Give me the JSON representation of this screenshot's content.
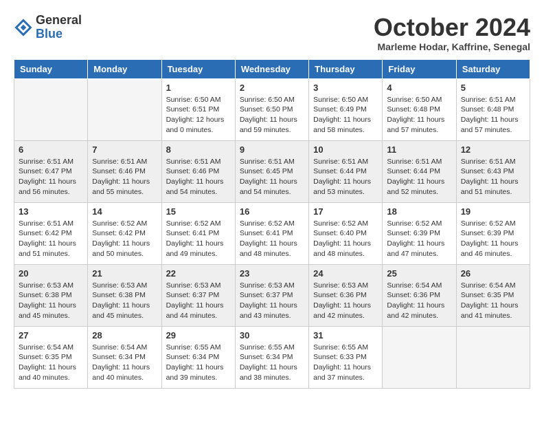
{
  "header": {
    "logo_general": "General",
    "logo_blue": "Blue",
    "month": "October 2024",
    "location": "Marleme Hodar, Kaffrine, Senegal"
  },
  "days_of_week": [
    "Sunday",
    "Monday",
    "Tuesday",
    "Wednesday",
    "Thursday",
    "Friday",
    "Saturday"
  ],
  "weeks": [
    [
      {
        "day": "",
        "info": ""
      },
      {
        "day": "",
        "info": ""
      },
      {
        "day": "1",
        "info": "Sunrise: 6:50 AM\nSunset: 6:51 PM\nDaylight: 12 hours\nand 0 minutes."
      },
      {
        "day": "2",
        "info": "Sunrise: 6:50 AM\nSunset: 6:50 PM\nDaylight: 11 hours\nand 59 minutes."
      },
      {
        "day": "3",
        "info": "Sunrise: 6:50 AM\nSunset: 6:49 PM\nDaylight: 11 hours\nand 58 minutes."
      },
      {
        "day": "4",
        "info": "Sunrise: 6:50 AM\nSunset: 6:48 PM\nDaylight: 11 hours\nand 57 minutes."
      },
      {
        "day": "5",
        "info": "Sunrise: 6:51 AM\nSunset: 6:48 PM\nDaylight: 11 hours\nand 57 minutes."
      }
    ],
    [
      {
        "day": "6",
        "info": "Sunrise: 6:51 AM\nSunset: 6:47 PM\nDaylight: 11 hours\nand 56 minutes."
      },
      {
        "day": "7",
        "info": "Sunrise: 6:51 AM\nSunset: 6:46 PM\nDaylight: 11 hours\nand 55 minutes."
      },
      {
        "day": "8",
        "info": "Sunrise: 6:51 AM\nSunset: 6:46 PM\nDaylight: 11 hours\nand 54 minutes."
      },
      {
        "day": "9",
        "info": "Sunrise: 6:51 AM\nSunset: 6:45 PM\nDaylight: 11 hours\nand 54 minutes."
      },
      {
        "day": "10",
        "info": "Sunrise: 6:51 AM\nSunset: 6:44 PM\nDaylight: 11 hours\nand 53 minutes."
      },
      {
        "day": "11",
        "info": "Sunrise: 6:51 AM\nSunset: 6:44 PM\nDaylight: 11 hours\nand 52 minutes."
      },
      {
        "day": "12",
        "info": "Sunrise: 6:51 AM\nSunset: 6:43 PM\nDaylight: 11 hours\nand 51 minutes."
      }
    ],
    [
      {
        "day": "13",
        "info": "Sunrise: 6:51 AM\nSunset: 6:42 PM\nDaylight: 11 hours\nand 51 minutes."
      },
      {
        "day": "14",
        "info": "Sunrise: 6:52 AM\nSunset: 6:42 PM\nDaylight: 11 hours\nand 50 minutes."
      },
      {
        "day": "15",
        "info": "Sunrise: 6:52 AM\nSunset: 6:41 PM\nDaylight: 11 hours\nand 49 minutes."
      },
      {
        "day": "16",
        "info": "Sunrise: 6:52 AM\nSunset: 6:41 PM\nDaylight: 11 hours\nand 48 minutes."
      },
      {
        "day": "17",
        "info": "Sunrise: 6:52 AM\nSunset: 6:40 PM\nDaylight: 11 hours\nand 48 minutes."
      },
      {
        "day": "18",
        "info": "Sunrise: 6:52 AM\nSunset: 6:39 PM\nDaylight: 11 hours\nand 47 minutes."
      },
      {
        "day": "19",
        "info": "Sunrise: 6:52 AM\nSunset: 6:39 PM\nDaylight: 11 hours\nand 46 minutes."
      }
    ],
    [
      {
        "day": "20",
        "info": "Sunrise: 6:53 AM\nSunset: 6:38 PM\nDaylight: 11 hours\nand 45 minutes."
      },
      {
        "day": "21",
        "info": "Sunrise: 6:53 AM\nSunset: 6:38 PM\nDaylight: 11 hours\nand 45 minutes."
      },
      {
        "day": "22",
        "info": "Sunrise: 6:53 AM\nSunset: 6:37 PM\nDaylight: 11 hours\nand 44 minutes."
      },
      {
        "day": "23",
        "info": "Sunrise: 6:53 AM\nSunset: 6:37 PM\nDaylight: 11 hours\nand 43 minutes."
      },
      {
        "day": "24",
        "info": "Sunrise: 6:53 AM\nSunset: 6:36 PM\nDaylight: 11 hours\nand 42 minutes."
      },
      {
        "day": "25",
        "info": "Sunrise: 6:54 AM\nSunset: 6:36 PM\nDaylight: 11 hours\nand 42 minutes."
      },
      {
        "day": "26",
        "info": "Sunrise: 6:54 AM\nSunset: 6:35 PM\nDaylight: 11 hours\nand 41 minutes."
      }
    ],
    [
      {
        "day": "27",
        "info": "Sunrise: 6:54 AM\nSunset: 6:35 PM\nDaylight: 11 hours\nand 40 minutes."
      },
      {
        "day": "28",
        "info": "Sunrise: 6:54 AM\nSunset: 6:34 PM\nDaylight: 11 hours\nand 40 minutes."
      },
      {
        "day": "29",
        "info": "Sunrise: 6:55 AM\nSunset: 6:34 PM\nDaylight: 11 hours\nand 39 minutes."
      },
      {
        "day": "30",
        "info": "Sunrise: 6:55 AM\nSunset: 6:34 PM\nDaylight: 11 hours\nand 38 minutes."
      },
      {
        "day": "31",
        "info": "Sunrise: 6:55 AM\nSunset: 6:33 PM\nDaylight: 11 hours\nand 37 minutes."
      },
      {
        "day": "",
        "info": ""
      },
      {
        "day": "",
        "info": ""
      }
    ]
  ]
}
